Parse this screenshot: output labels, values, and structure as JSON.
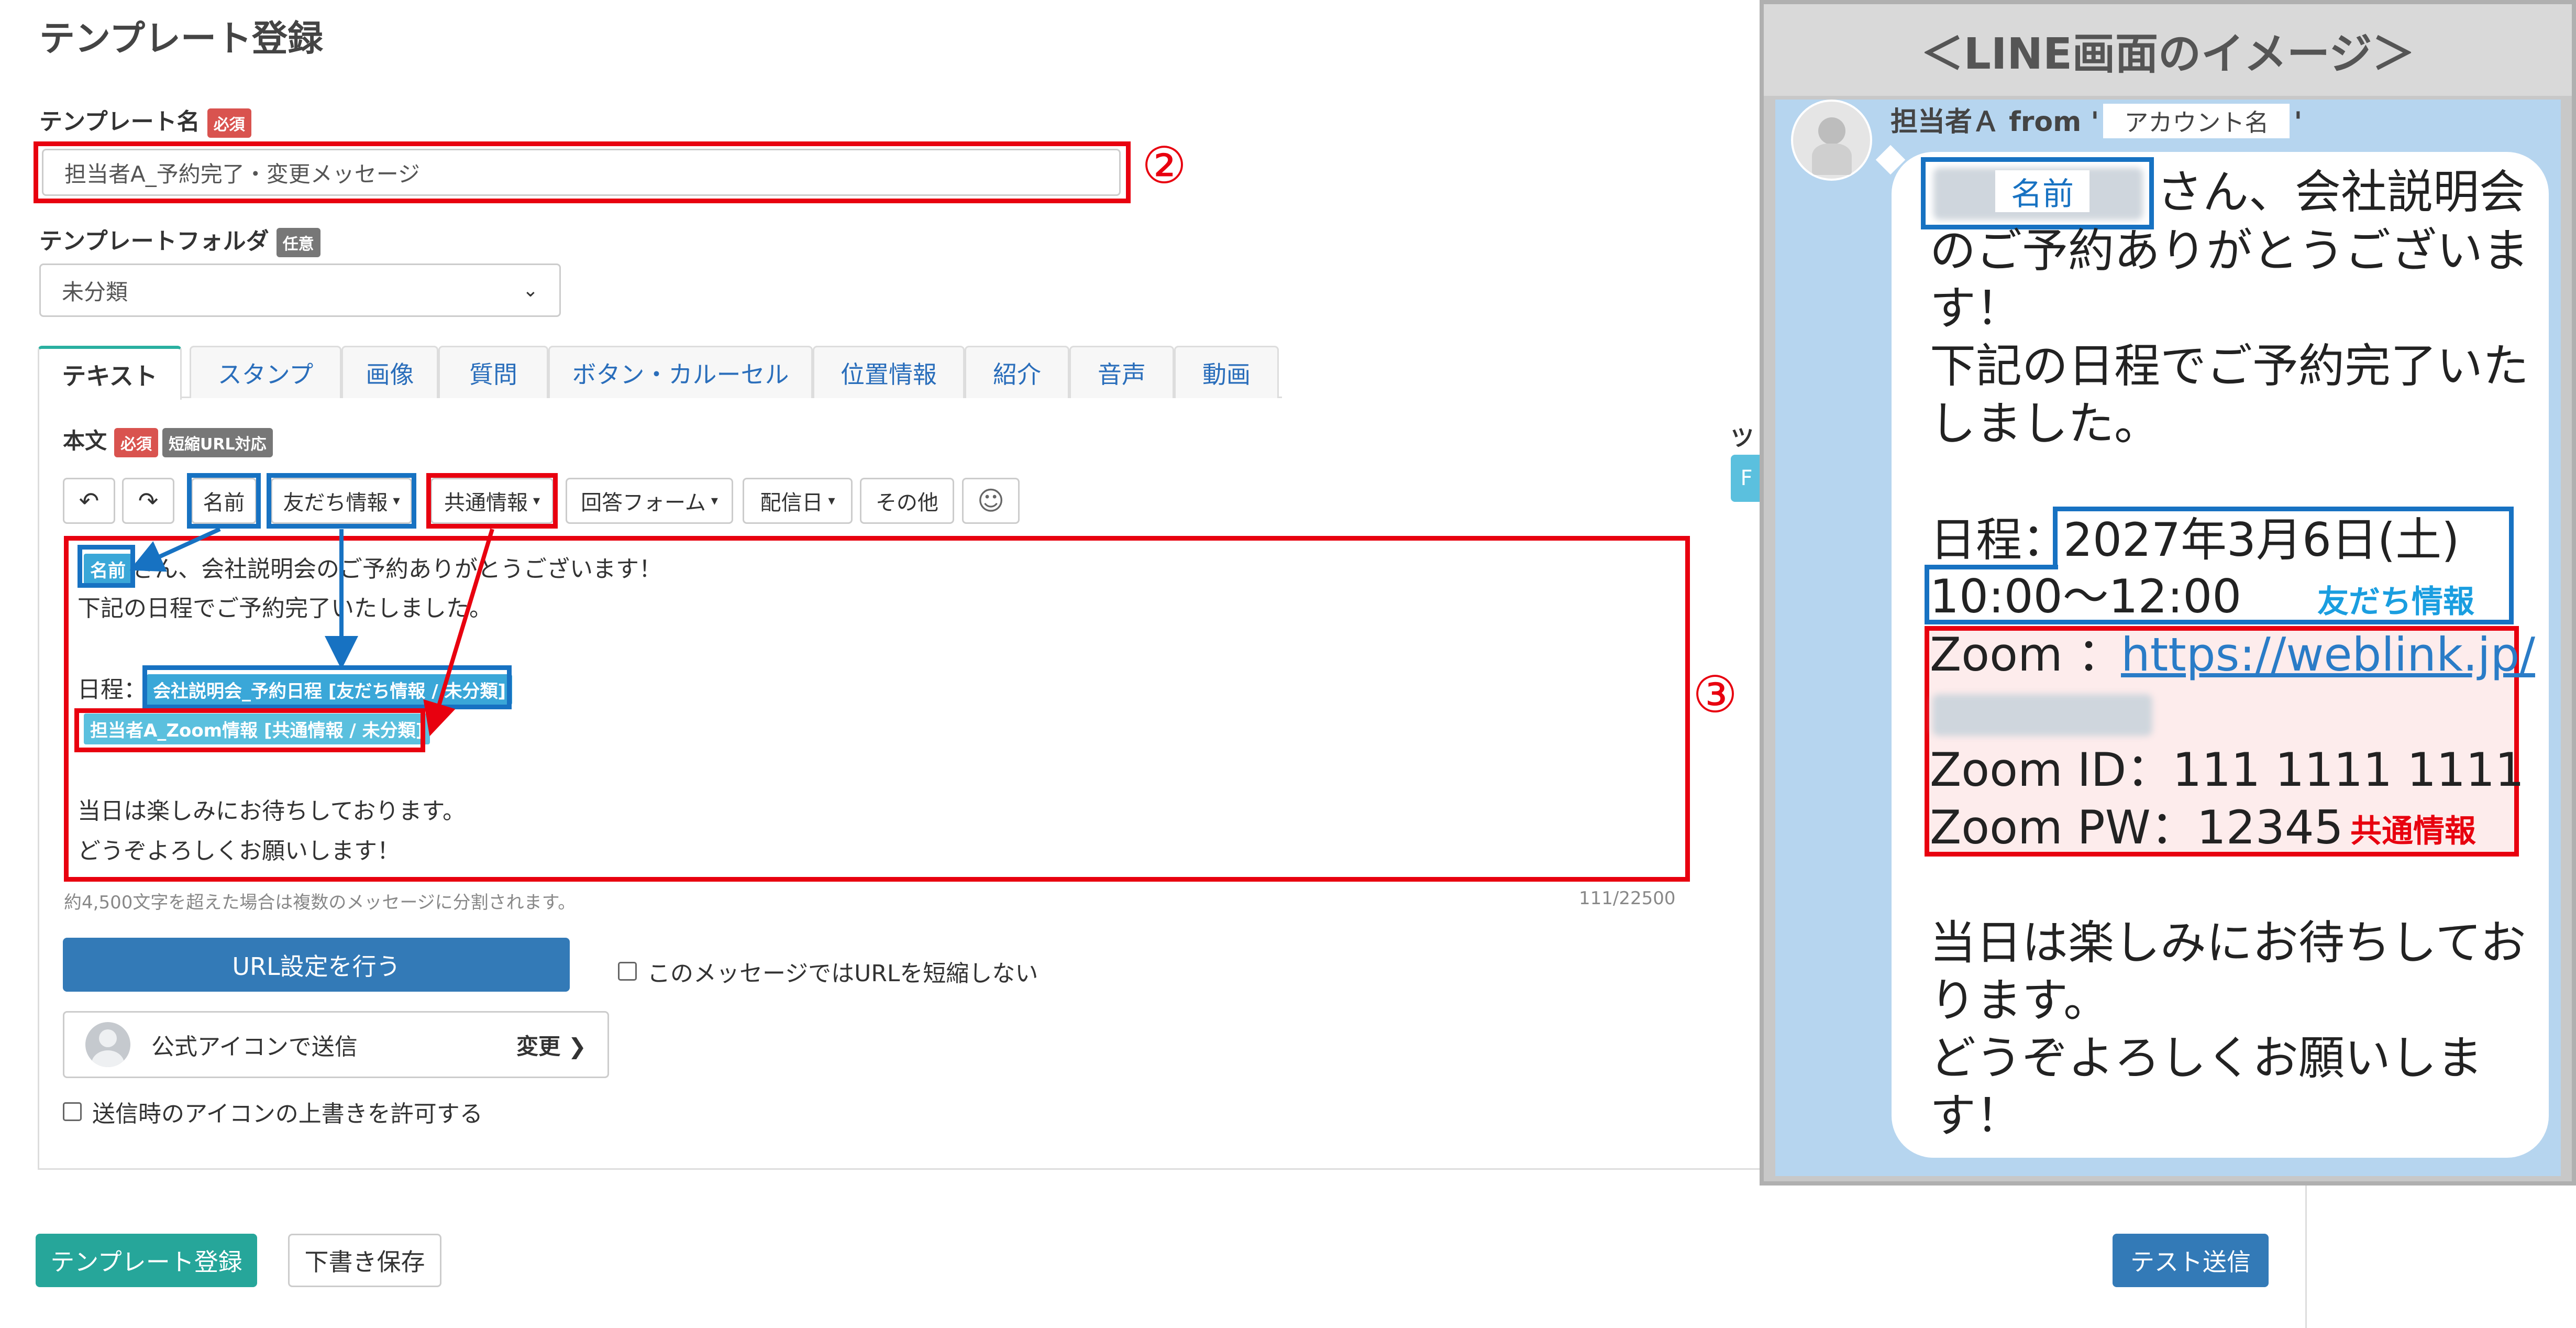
{
  "page": {
    "title": "テンプレート登録"
  },
  "template_name": {
    "label": "テンプレート名",
    "badge": "必須",
    "value": "担当者A_予約完了・変更メッセージ",
    "marker": "②"
  },
  "template_folder": {
    "label": "テンプレートフォルダ",
    "badge": "任意",
    "selected": "未分類"
  },
  "tabs": [
    "テキスト",
    "スタンプ",
    "画像",
    "質問",
    "ボタン・カルーセル",
    "位置情報",
    "紹介",
    "音声",
    "動画"
  ],
  "body": {
    "label": "本文",
    "badge_required": "必須",
    "badge_short_url": "短縮URL対応",
    "side_label": "ツ",
    "side_button": "F"
  },
  "toolbar": {
    "undo_icon": "undo-icon",
    "redo_icon": "redo-icon",
    "name": "名前",
    "friend_info": "友だち情報",
    "common_info": "共通情報",
    "answer_form": "回答フォーム",
    "delivery_date": "配信日",
    "other": "その他",
    "emoji_icon": "smiley-icon"
  },
  "editor": {
    "chip_name": "名前",
    "line1": "さん、会社説明会のご予約ありがとうございます！",
    "line2": "下記の日程でご予約完了いたしました。",
    "line3_label": "日程：",
    "chip_friend": "会社説明会_予約日程 [友だち情報 / 未分類]",
    "chip_common": "担当者A_Zoom情報 [共通情報 / 未分類]",
    "line4": "当日は楽しみにお待ちしております。",
    "line5": "どうぞよろしくお願いします！",
    "marker": "③"
  },
  "editor_note": "約4,500文字を超えた場合は複数のメッセージに分割されます。",
  "char_count": "111/22500",
  "url_button": "URL設定を行う",
  "no_shorten_label": "このメッセージではURLを短縮しない",
  "icon_send": {
    "label": "公式アイコンで送信",
    "change": "変更"
  },
  "allow_icon_override": "送信時のアイコンの上書きを許可する",
  "footer": {
    "register": "テンプレート登録",
    "draft": "下書き保存",
    "test_send": "テスト送信"
  },
  "line_preview": {
    "header": "＜LINE画面のイメージ＞",
    "sender": "担当者Ａ from '",
    "account_name": "アカウント名",
    "sender_end": "'",
    "name_tag": "名前",
    "l1": "さん、会社説明会",
    "l2": "のご予約ありがとうございま",
    "l3": "す！",
    "l4": "下記の日程でご予約完了いた",
    "l5": "しました。",
    "date_label": "日程：",
    "date_value": "2027年3月6日(土)",
    "time_value": "10:00～12:00",
    "friend_tag": "友だち情報",
    "zoom_label": "Zoom ：",
    "zoom_link": "https://weblink.jp/",
    "zoom_id": "Zoom ID：111 1111 1111",
    "zoom_pw": "Zoom PW：12345",
    "common_tag": "共通情報",
    "l6": "当日は楽しみにお待ちしてお",
    "l7": "ります。",
    "l8": "どうぞよろしくお願いしま",
    "l9": "す！"
  },
  "colors": {
    "annotation_red": "#e8000f",
    "annotation_blue": "#1772c2",
    "primary": "#337ab7",
    "success": "#26a69a",
    "line_bg": "#b6d5ef"
  }
}
